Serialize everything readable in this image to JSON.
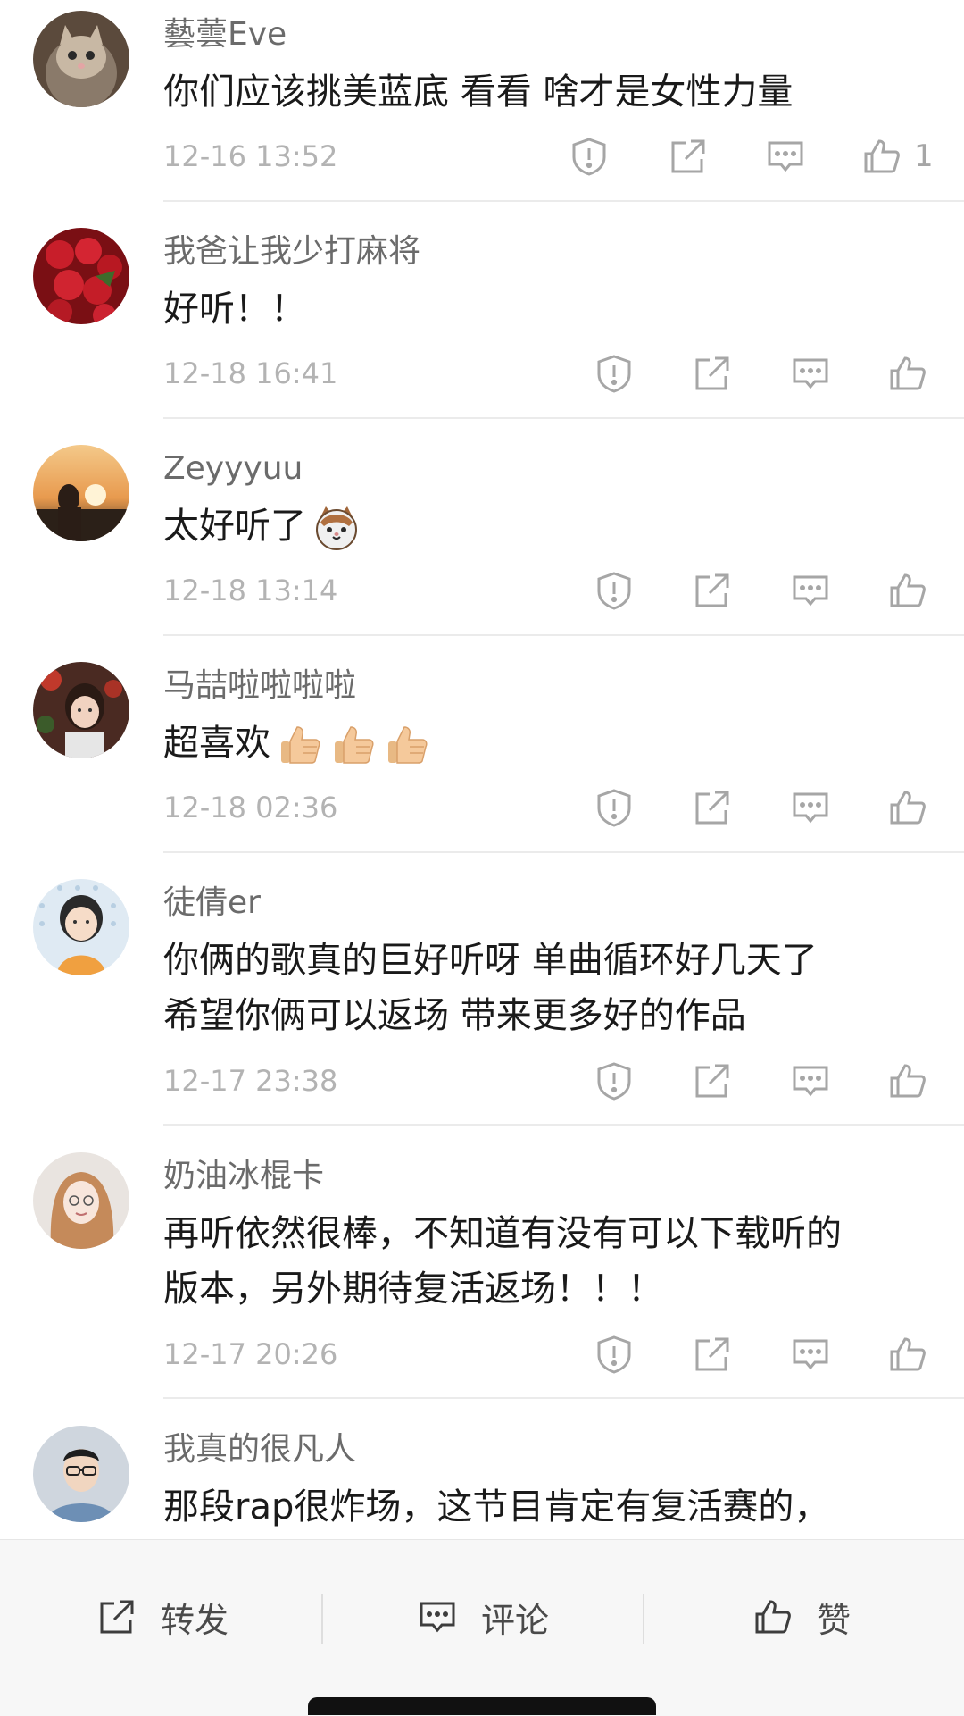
{
  "comments": [
    {
      "username": "藝蕓Eve",
      "lines": [
        "你们应该挑美蓝底 看看 啥才是女性力量"
      ],
      "timestamp": "12-16 13:52",
      "likes": "1"
    },
    {
      "username": "我爸让我少打麻将",
      "lines": [
        "好听！！"
      ],
      "timestamp": "12-18 16:41",
      "likes": ""
    },
    {
      "username": "Zeyyyuu",
      "lines": [
        "太好听了"
      ],
      "timestamp": "12-18 13:14",
      "likes": "",
      "emoji": "cat-face-emoji"
    },
    {
      "username": "马喆啦啦啦啦",
      "lines": [
        "超喜欢"
      ],
      "timestamp": "12-18 02:36",
      "likes": "",
      "emoji": "thumbs-up-emoji"
    },
    {
      "username": "徒倩er",
      "lines": [
        "你俩的歌真的巨好听呀  单曲循环好几天了",
        "希望你俩可以返场  带来更多好的作品"
      ],
      "timestamp": "12-17 23:38",
      "likes": ""
    },
    {
      "username": "奶油冰棍卡",
      "lines": [
        "再听依然很棒，不知道有没有可以下载听的",
        "版本，另外期待复活返场！！！"
      ],
      "timestamp": "12-17 20:26",
      "likes": ""
    },
    {
      "username": "我真的很凡人",
      "lines": [
        "那段rap很炸场，这节目肯定有复活赛的，"
      ],
      "timestamp": "",
      "likes": ""
    }
  ],
  "bottom_bar": {
    "repost_label": "转发",
    "comment_label": "评论",
    "like_label": "赞"
  },
  "icons": {
    "report": "report-icon",
    "share": "share-icon",
    "reply": "reply-icon",
    "like": "like-icon"
  },
  "colors": {
    "text": "#1a1a1a",
    "username": "#6b6b6b",
    "timestamp": "#b3b3b3",
    "icon": "#a6a6a6",
    "bar_bg": "#f7f7f7"
  }
}
